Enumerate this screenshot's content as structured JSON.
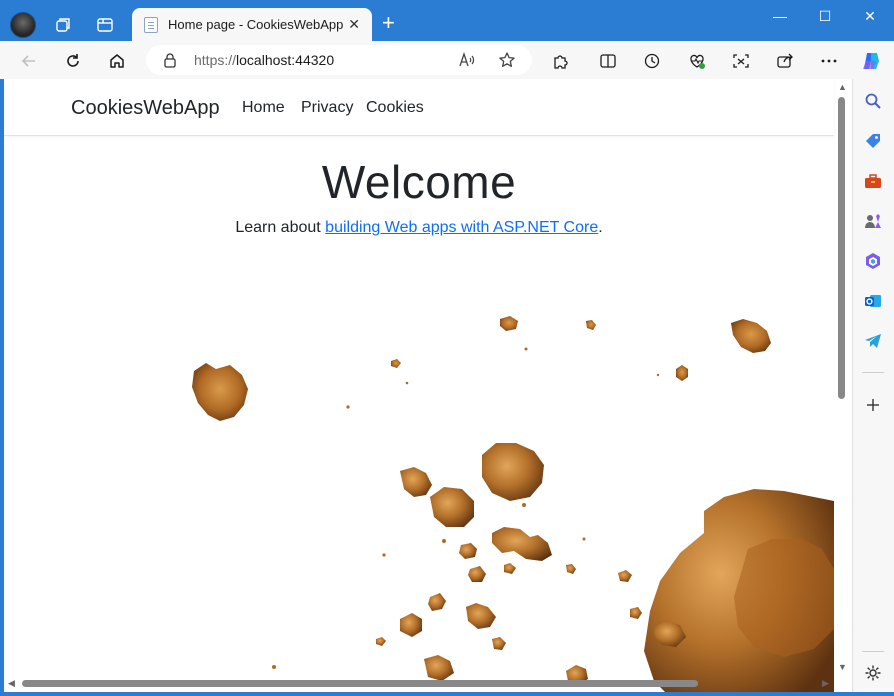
{
  "browser": {
    "tab_title": "Home page - CookiesWebApp",
    "tab_close": "✕",
    "new_tab": "+",
    "address_protocol": "https://",
    "address_host": "localhost:44320",
    "accent_color": "#2b7cd3",
    "window_controls": {
      "minimize": "—",
      "maximize": "☐",
      "close": "✕"
    }
  },
  "site": {
    "brand": "CookiesWebApp",
    "nav": [
      "Home",
      "Privacy",
      "Cookies"
    ],
    "heading": "Welcome",
    "learn_prefix": "Learn about ",
    "learn_link": "building Web apps with ASP.NET Core",
    "learn_suffix": ".",
    "link_color": "#0d6efd"
  },
  "sidebar": {
    "icons": [
      "search-icon",
      "tag-icon",
      "toolbox-icon",
      "people-icon",
      "office-icon",
      "outlook-icon",
      "telegram-icon",
      "add-icon",
      "settings-icon"
    ]
  }
}
